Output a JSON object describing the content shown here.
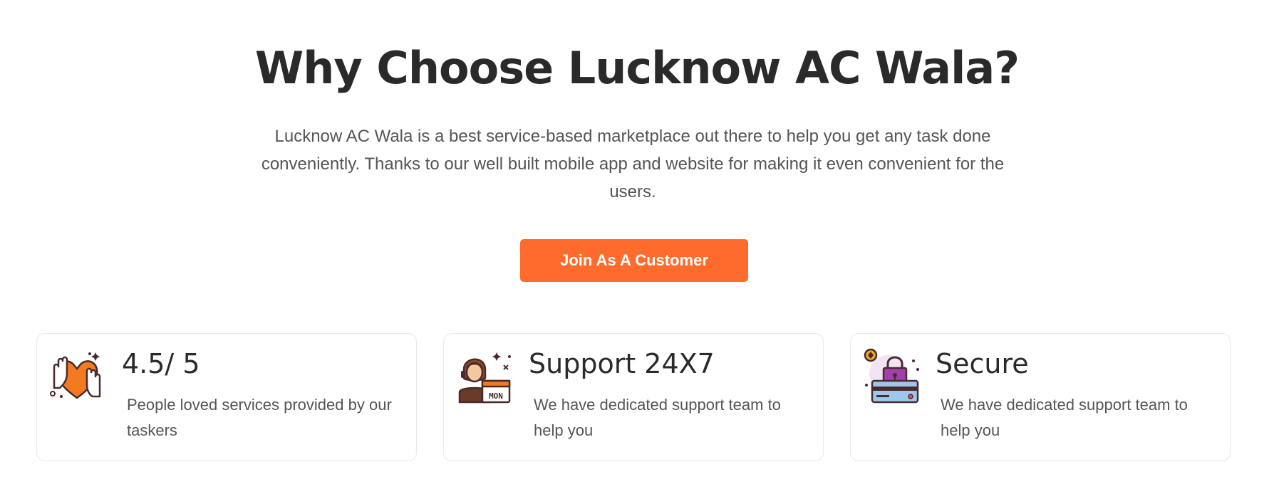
{
  "section": {
    "heading": "Why Choose Lucknow AC Wala?",
    "intro": "Lucknow AC Wala is a best service-based marketplace out there to help you get any task done conveniently. Thanks to our well built mobile app and website for making it even convenient for the users.",
    "cta_label": "Join As A Customer"
  },
  "features": [
    {
      "icon": "heart-hands-icon",
      "title": "4.5/ 5",
      "description": "People loved services provided by our taskers"
    },
    {
      "icon": "support-agent-icon",
      "title": "Support 24X7",
      "description": "We have dedicated support team to help you",
      "calendar_label": "MON"
    },
    {
      "icon": "secure-payment-icon",
      "title": "Secure",
      "description": "We have dedicated support team to help you"
    }
  ],
  "colors": {
    "accent": "#ff6b2c",
    "heading": "#2a2a2a",
    "body_text": "#555555",
    "card_border": "#e8e8ee"
  }
}
